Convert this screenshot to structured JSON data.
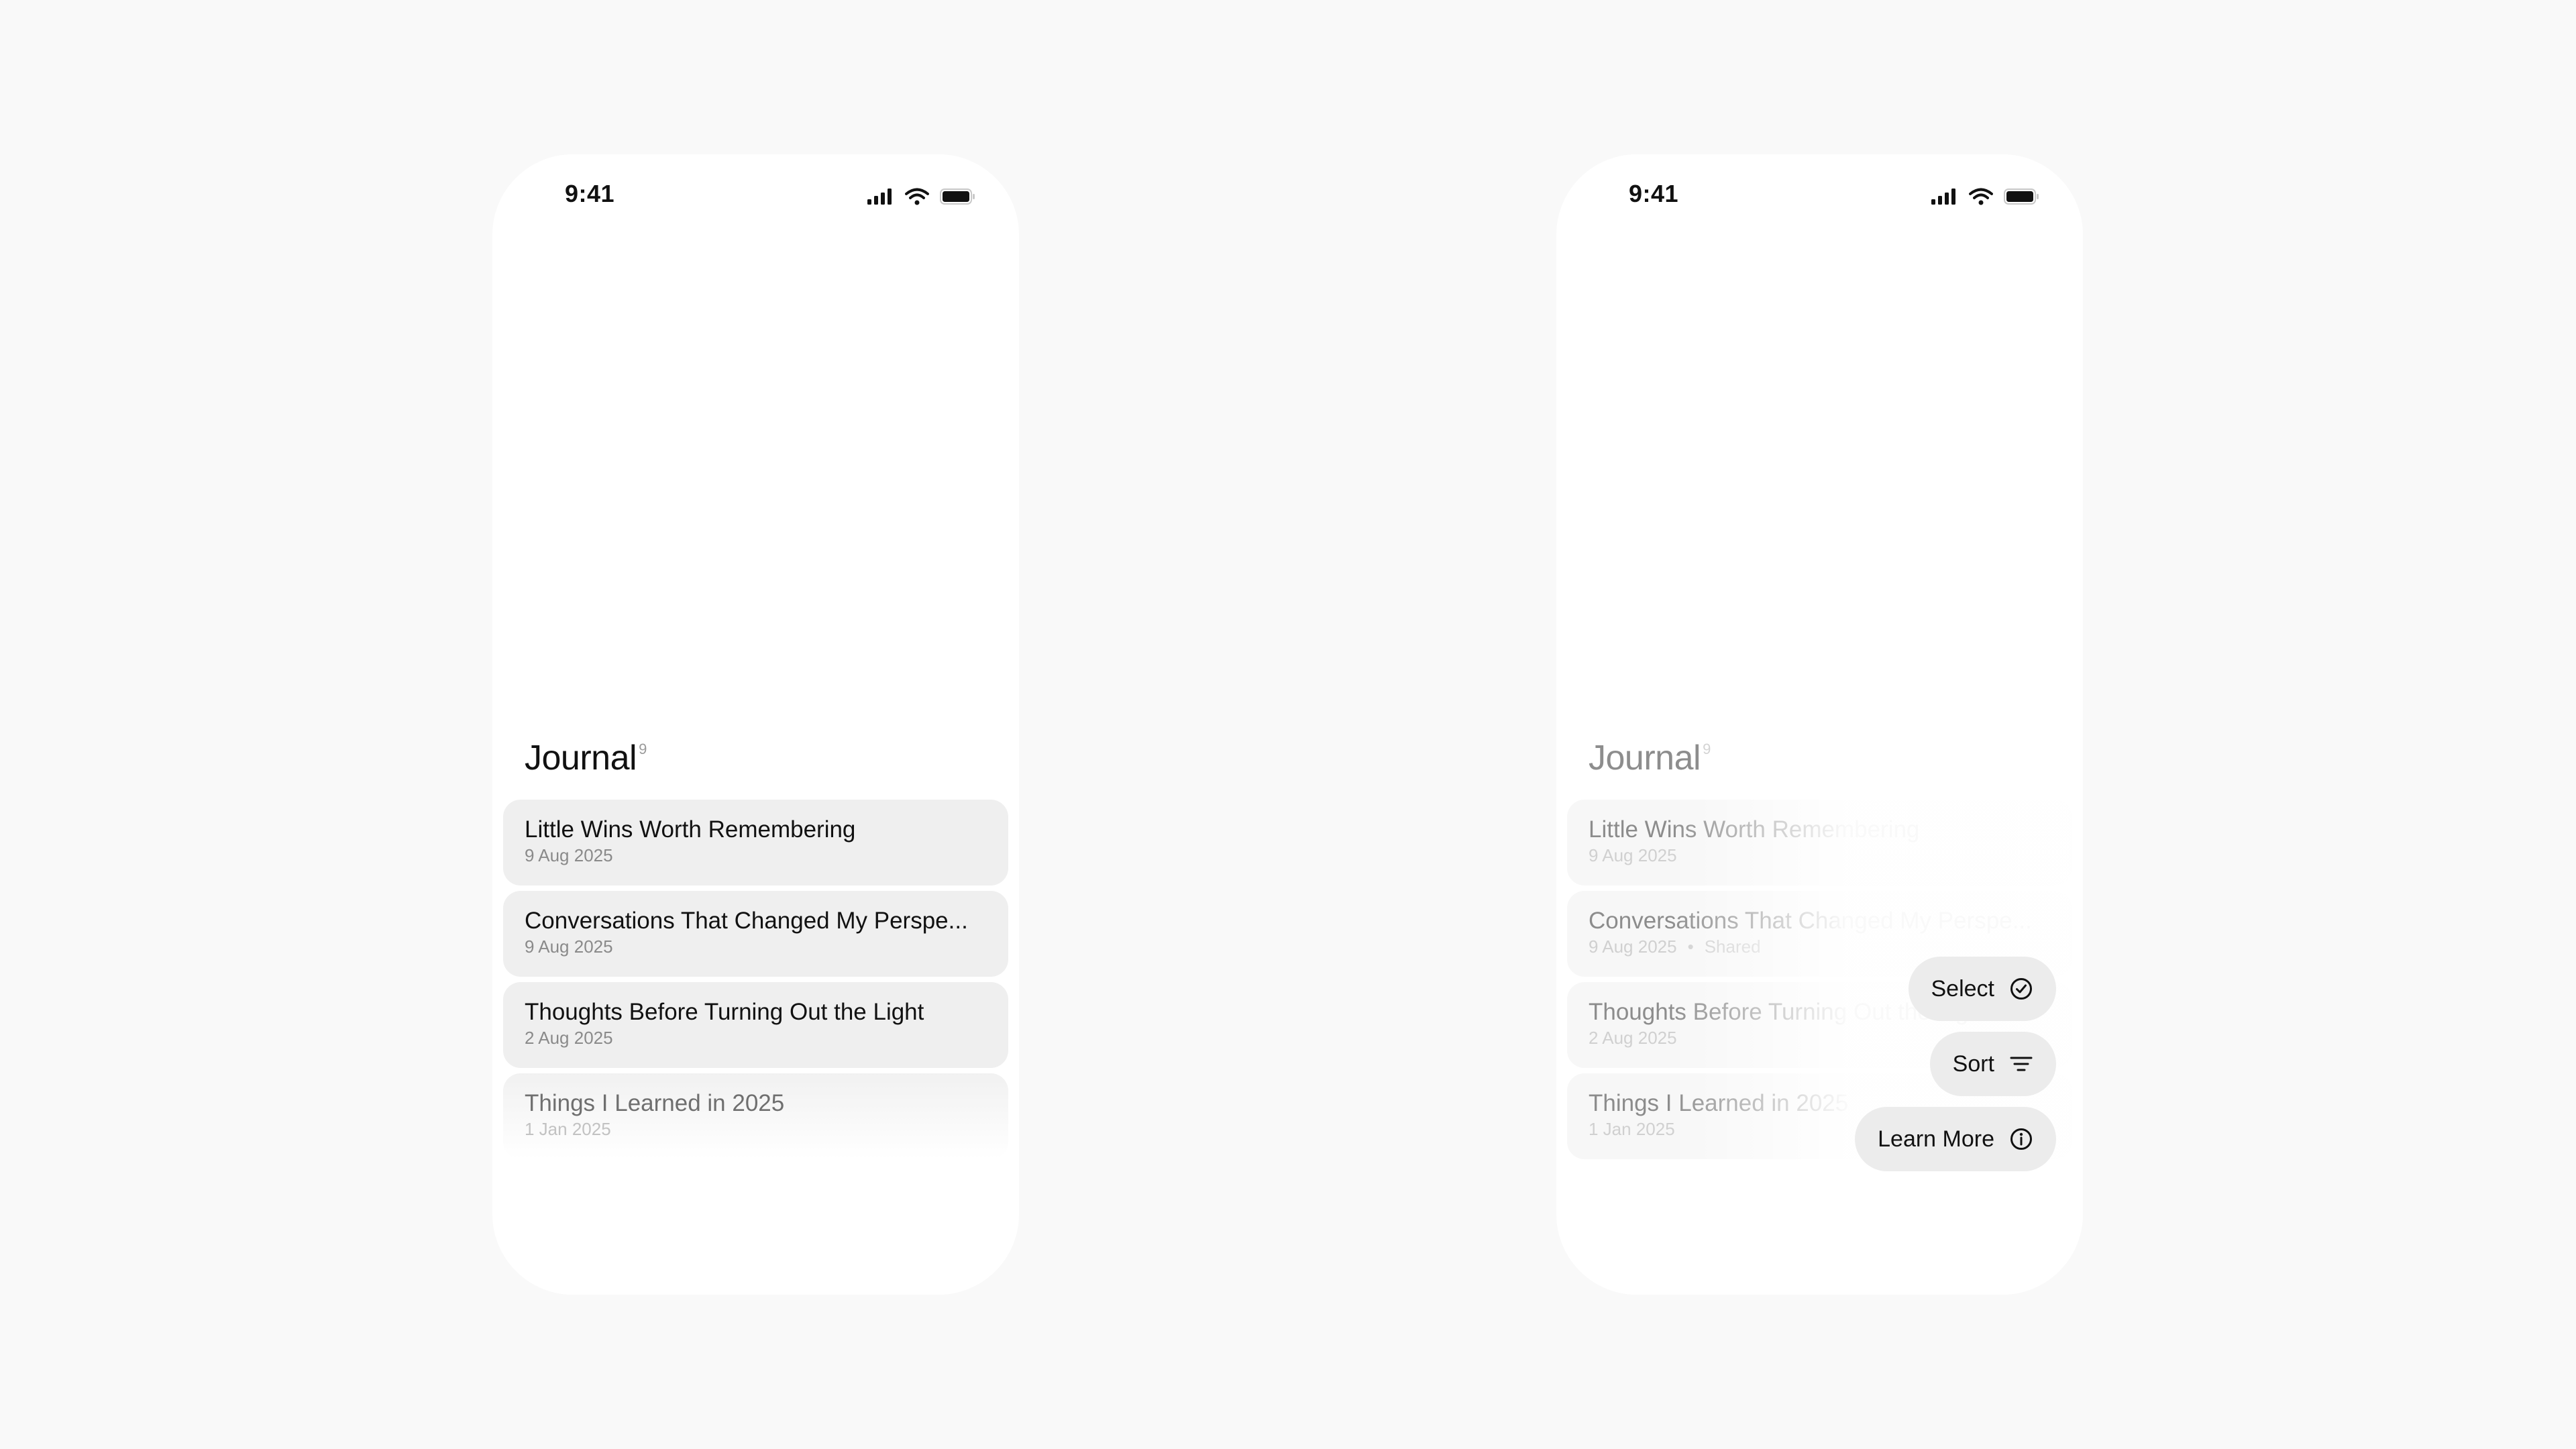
{
  "status_bar": {
    "time": "9:41"
  },
  "journal": {
    "title": "Journal",
    "count": "9",
    "notes": [
      {
        "title": "Little Wins Worth Remembering",
        "date": "9 Aug 2025"
      },
      {
        "title": "Conversations That Changed My Perspe...",
        "date": "9 Aug 2025",
        "shared": "Shared"
      },
      {
        "title": "Thoughts Before Turning Out the Light",
        "date": "2 Aug 2025"
      },
      {
        "title": "Things I Learned in 2025",
        "date": "1 Jan 2025"
      }
    ]
  },
  "menu": {
    "items": [
      {
        "label": "Select",
        "icon": "checkmark-circle-icon"
      },
      {
        "label": "Sort",
        "icon": "sort-lines-icon"
      },
      {
        "label": "Learn More",
        "icon": "info-circle-icon"
      }
    ]
  },
  "toolbar": {
    "left_icon": "collapse-arrows-icon",
    "center_icon": "plus-icon",
    "right_icon_default": "more-dots-icon",
    "right_icon_menu_open": "close-icon"
  }
}
